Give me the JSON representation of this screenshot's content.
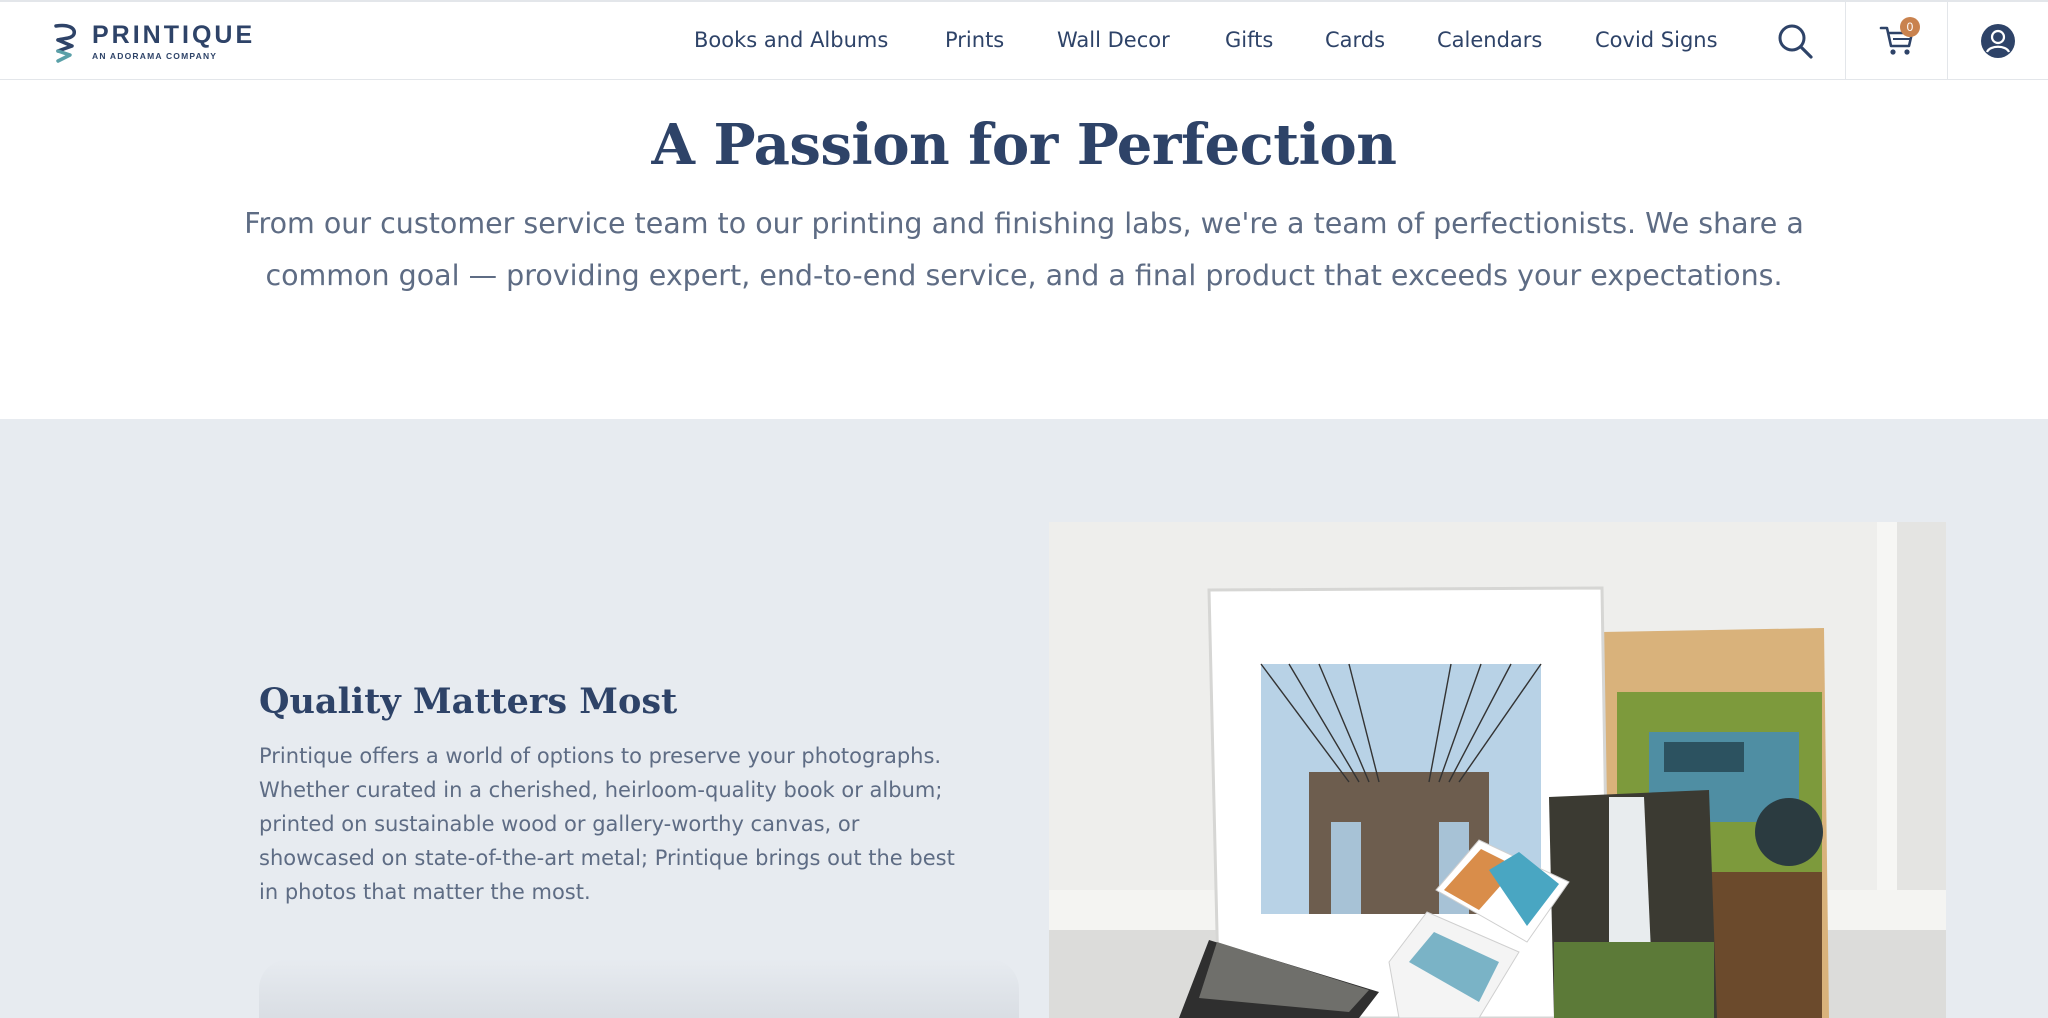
{
  "brand": {
    "name": "PRINTIQUE",
    "tagline": "AN ADORAMA COMPANY"
  },
  "nav": {
    "items": [
      {
        "label": "Books and Albums"
      },
      {
        "label": "Prints"
      },
      {
        "label": "Wall Decor"
      },
      {
        "label": "Gifts"
      },
      {
        "label": "Cards"
      },
      {
        "label": "Calendars"
      },
      {
        "label": "Covid Signs"
      }
    ]
  },
  "header_icons": {
    "search": "search-icon",
    "cart": "cart-icon",
    "cart_count": "0",
    "account": "account-icon"
  },
  "intro": {
    "title": "A Passion for Perfection",
    "text": "From our customer service team to our printing and finishing labs, we're a team of perfectionists. We share a common goal — providing expert, end-to-end service, and a final product that exceeds your expectations."
  },
  "quality": {
    "title": "Quality Matters Most",
    "text": "Printique offers a world of options to preserve your photographs. Whether curated in a cherished, heirloom-quality book or album; printed on sustainable wood or gallery-worthy canvas, or showcased on state-of-the-art metal; Printique brings out the best in photos that matter the most."
  },
  "colors": {
    "brand_navy": "#2e4368",
    "body_text": "#5e6c84",
    "section_bg": "#e7ebf0",
    "badge": "#c9824e"
  }
}
